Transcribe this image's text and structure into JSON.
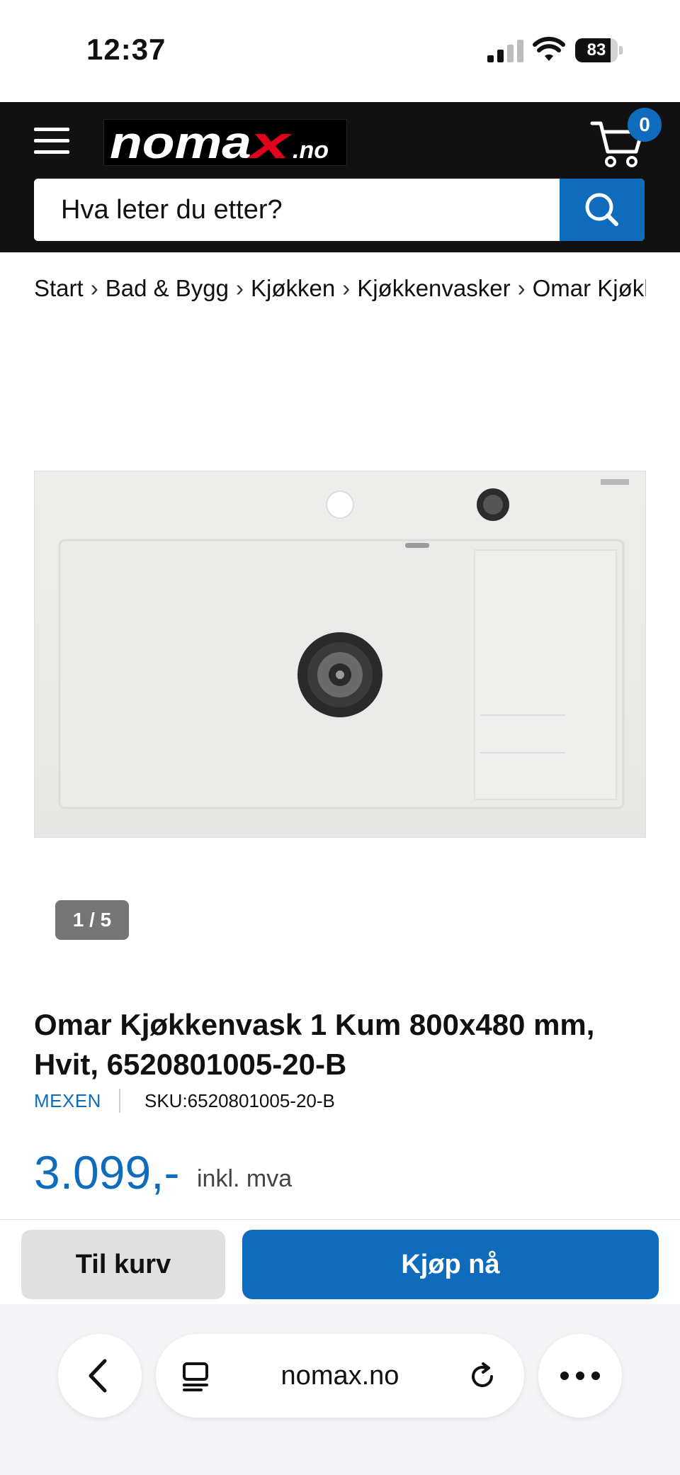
{
  "status_bar": {
    "time": "12:37",
    "battery_level": "83",
    "battery_fraction": 0.83
  },
  "header": {
    "logo_text": "nomax",
    "logo_suffix": ".no",
    "cart_count": "0",
    "search_placeholder": "Hva leter du etter?",
    "brand_colors": {
      "header_bg": "#111111",
      "accent_blue": "#0f6cbd",
      "logo_red": "#e3001b"
    }
  },
  "breadcrumb": [
    "Start",
    "Bad & Bygg",
    "Kjøkken",
    "Kjøkkenvasker",
    "Omar Kjøkkenvask"
  ],
  "breadcrumb_separator": "›",
  "gallery": {
    "counter": "1 / 5"
  },
  "product": {
    "title": "Omar Kjøkkenvask 1 Kum 800x480 mm, Hvit, 6520801005-20-B",
    "brand": "MEXEN",
    "sku": "SKU:6520801005-20-B",
    "price": "3.099,-",
    "vat_note": "inkl. mva"
  },
  "actions": {
    "add_to_cart": "Til kurv",
    "buy_now": "Kjøp nå"
  },
  "browser": {
    "url": "nomax.no"
  },
  "icons": [
    "hamburger-menu-icon",
    "cart-icon",
    "search-icon",
    "back-icon",
    "tabs-icon",
    "reload-icon",
    "more-icon",
    "signal-icon",
    "wifi-icon",
    "battery-icon"
  ]
}
